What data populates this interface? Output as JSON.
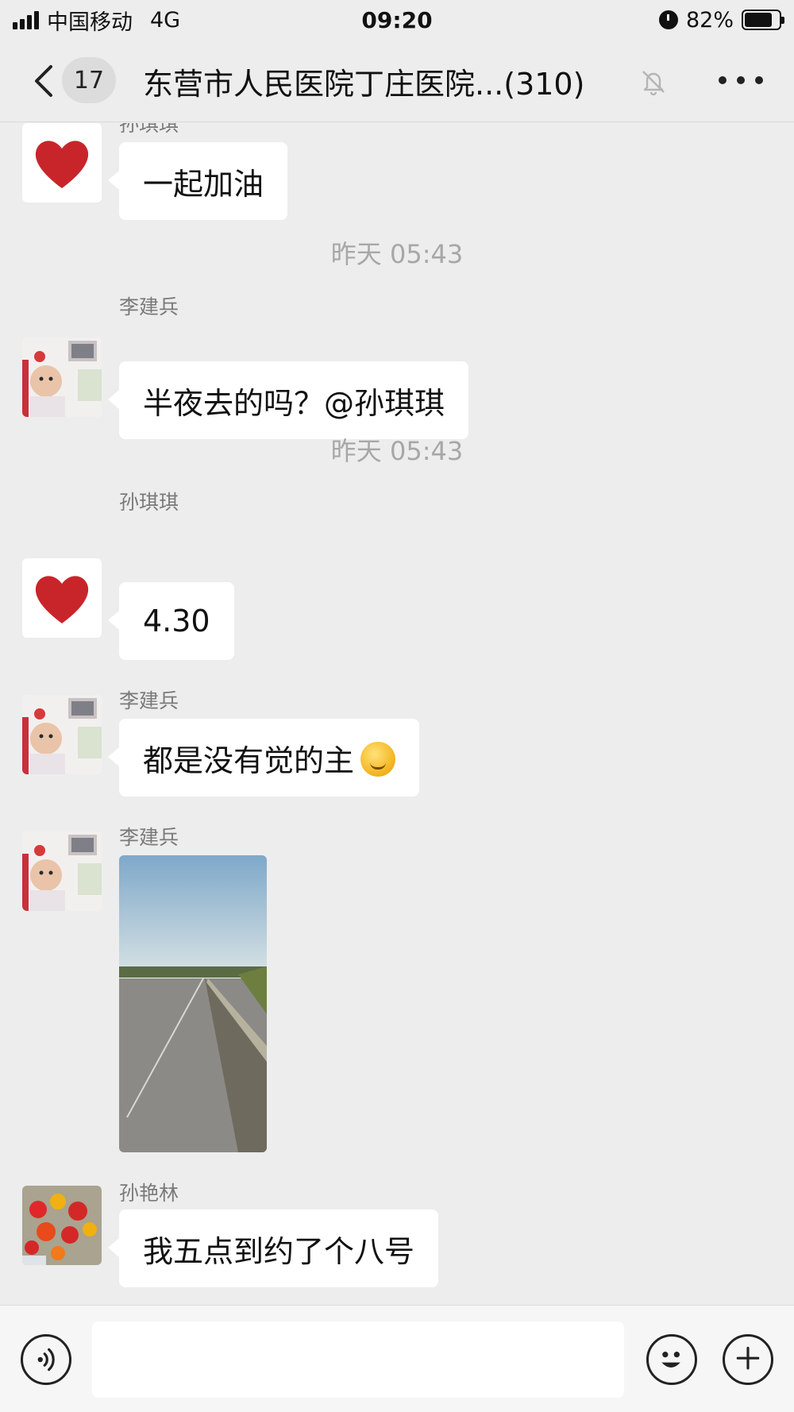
{
  "status_bar": {
    "carrier": "中国移动",
    "network": "4G",
    "time": "09:20",
    "battery_percent": "82%",
    "battery_level": 0.82
  },
  "nav": {
    "unread_count": "17",
    "title": "东营市人民医院丁庄医院...(310)"
  },
  "messages": [
    {
      "sender": "孙琪琪",
      "text": "一起加油",
      "avatar": "red-heart"
    },
    {
      "timestamp": "昨天 05:43"
    },
    {
      "sender": "李建兵",
      "text": "半夜去的吗？@孙琪琪",
      "avatar": "baby-photo"
    },
    {
      "timestamp": "昨天 05:43"
    },
    {
      "sender": "孙琪琪",
      "text": "4.30",
      "avatar": "red-heart"
    },
    {
      "sender": "李建兵",
      "text": "都是没有觉的主",
      "emoji": "thinking-face",
      "avatar": "baby-photo"
    },
    {
      "sender": "李建兵",
      "image": "road-photo",
      "avatar": "baby-photo"
    },
    {
      "sender": "孙艳林",
      "text": "我五点到约了个八号",
      "avatar": "flowers-photo"
    }
  ],
  "colors": {
    "background": "#ededed",
    "bubble": "#ffffff",
    "heart": "#c8252b"
  }
}
